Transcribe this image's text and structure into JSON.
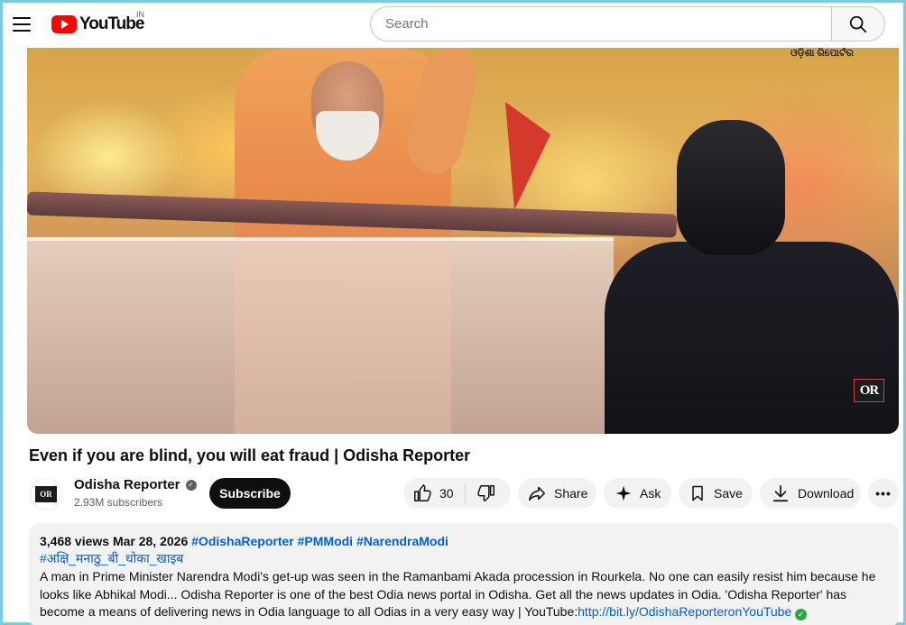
{
  "header": {
    "logo_text": "YouTube",
    "region": "IN",
    "search_placeholder": "Search"
  },
  "video": {
    "overlay_text": "ଓଡ଼ିଶା ରିପୋର୍ଟର",
    "brand_logo": "OR"
  },
  "title": "Even if you are blind, you will eat fraud | Odisha Reporter",
  "channel": {
    "name": "Odisha Reporter",
    "subscribers": "2.93M subscribers",
    "avatar_text": "OR",
    "subscribe_label": "Subscribe"
  },
  "actions": {
    "likes": "30",
    "share": "Share",
    "ask": "Ask",
    "save": "Save",
    "download": "Download",
    "more": "•••"
  },
  "description": {
    "views": "3,468 views",
    "date": "Mar 28, 2026",
    "tags": [
      "#OdishaReporter",
      "#PMModi",
      "#NarendraModi"
    ],
    "hindi_tag": "#अक्षि_मनाठु_बी_धोका_खाइब",
    "body": "A man in Prime Minister Narendra Modi's get-up was seen in the Ramanbami Akada procession in Rourkela. No one can easily resist him because he looks like Abhikal Modi... Odisha Reporter is one of the best Odia news portal in Odisha. Get all the news updates in Odia. 'Odisha Reporter' has become a means of delivering news in Odia language to all Odias in a very easy way | YouTube:",
    "link": "http://bit.ly/OdishaReporteronYouTube"
  },
  "colors": {
    "accent_red": "#ff0000",
    "link_blue": "#065fd4",
    "pill_bg": "#f2f2f2",
    "subscribe_bg": "#0f0f0f"
  }
}
